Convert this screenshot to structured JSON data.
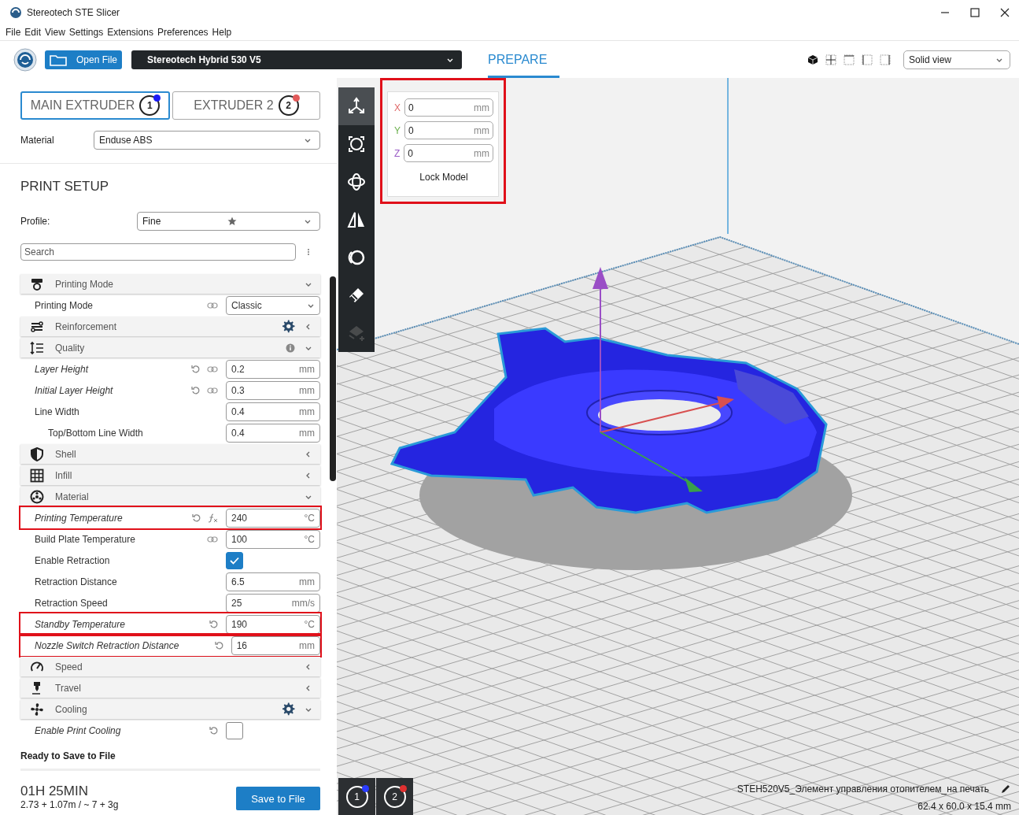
{
  "window": {
    "title": "Stereotech STE Slicer"
  },
  "menu": [
    "File",
    "Edit",
    "View",
    "Settings",
    "Extensions",
    "Preferences",
    "Help"
  ],
  "toolbar": {
    "open_file": "Open File",
    "printer": "Stereotech Hybrid 530 V5",
    "stages": [
      {
        "label": "PREPARE",
        "selected": true
      }
    ],
    "view_mode": "Solid view"
  },
  "extruders": [
    {
      "label": "MAIN EXTRUDER",
      "number": "1",
      "color": "#1b1bf5",
      "selected": true
    },
    {
      "label": "EXTRUDER 2",
      "number": "2",
      "color": "#e25a5a",
      "selected": false
    }
  ],
  "material": {
    "label": "Material",
    "value": "Enduse ABS"
  },
  "print_setup": {
    "title": "PRINT SETUP",
    "profile_label": "Profile:",
    "profile": "Fine",
    "search_placeholder": "Search",
    "settings": [
      {
        "kind": "category",
        "label": "Printing Mode",
        "expanded": true
      },
      {
        "kind": "select",
        "label": "Printing Mode",
        "linked": true,
        "value": "Classic"
      },
      {
        "kind": "category",
        "label": "Reinforcement",
        "expanded": false,
        "show_settings": true
      },
      {
        "kind": "category",
        "label": "Quality",
        "expanded": true,
        "show_info": true
      },
      {
        "kind": "field",
        "label": "Layer Height",
        "overridden": true,
        "linked": true,
        "resettable": true,
        "value": "0.2",
        "unit": "mm"
      },
      {
        "kind": "field",
        "label": "Initial Layer Height",
        "overridden": true,
        "linked": true,
        "resettable": true,
        "value": "0.3",
        "unit": "mm"
      },
      {
        "kind": "field",
        "label": "Line Width",
        "value": "0.4",
        "unit": "mm",
        "children": [
          {
            "kind": "field",
            "label": "Top/Bottom Line Width",
            "value": "0.4",
            "unit": "mm"
          }
        ]
      },
      {
        "kind": "category",
        "label": "Shell",
        "expanded": false
      },
      {
        "kind": "category",
        "label": "Infill",
        "expanded": false
      },
      {
        "kind": "category",
        "label": "Material",
        "expanded": true
      },
      {
        "kind": "field",
        "label": "Printing Temperature",
        "overridden": true,
        "resettable": true,
        "formula": true,
        "value": "240",
        "unit": "°C",
        "highlighted": true
      },
      {
        "kind": "field",
        "label": "Build Plate Temperature",
        "linked": true,
        "value": "100",
        "unit": "°C"
      },
      {
        "kind": "checkbox",
        "label": "Enable Retraction",
        "checked": true
      },
      {
        "kind": "field",
        "label": "Retraction Distance",
        "value": "6.5",
        "unit": "mm"
      },
      {
        "kind": "field",
        "label": "Retraction Speed",
        "value": "25",
        "unit": "mm/s"
      },
      {
        "kind": "field",
        "label": "Standby Temperature",
        "overridden": true,
        "resettable": true,
        "value": "190",
        "unit": "°C",
        "highlighted": true
      },
      {
        "kind": "field",
        "label": "Nozzle Switch Retraction Distance",
        "overridden": true,
        "resettable": true,
        "value": "16",
        "unit": "mm",
        "highlighted": true
      },
      {
        "kind": "category",
        "label": "Speed",
        "expanded": false
      },
      {
        "kind": "category",
        "label": "Travel",
        "expanded": false
      },
      {
        "kind": "category",
        "label": "Cooling",
        "expanded": true,
        "show_settings": true
      },
      {
        "kind": "checkbox",
        "label": "Enable Print Cooling",
        "overridden": true,
        "resettable": true,
        "checked": false
      }
    ]
  },
  "footer": {
    "status": "Ready to Save to File",
    "time": "01H 25MIN",
    "usage": "2.73 + 1.07m / ~ 7 + 3g",
    "save": "Save to File"
  },
  "move_panel": {
    "highlighted": true,
    "lock": "Lock Model",
    "fields": [
      {
        "axis": "X",
        "value": "0",
        "unit": "mm",
        "color": "#e06a6a"
      },
      {
        "axis": "Y",
        "value": "0",
        "unit": "mm",
        "color": "#6ab04c"
      },
      {
        "axis": "Z",
        "value": "0",
        "unit": "mm",
        "color": "#9a5cc6"
      }
    ]
  },
  "tools": [
    {
      "selected": true,
      "disabled": false
    },
    {
      "selected": false,
      "disabled": false
    },
    {
      "selected": false,
      "disabled": false
    },
    {
      "selected": false,
      "disabled": false
    },
    {
      "selected": false,
      "disabled": false
    },
    {
      "selected": false,
      "disabled": false
    },
    {
      "selected": false,
      "disabled": true
    }
  ],
  "viewport_extruders": [
    {
      "number": "1",
      "color": "#2a3cff"
    },
    {
      "number": "2",
      "color": "#e03030"
    }
  ],
  "object": {
    "name": "STEH520V5_Элемент управления отопителем_на печать",
    "dimensions": "62.4 x 60.0 x 15.4 mm"
  }
}
